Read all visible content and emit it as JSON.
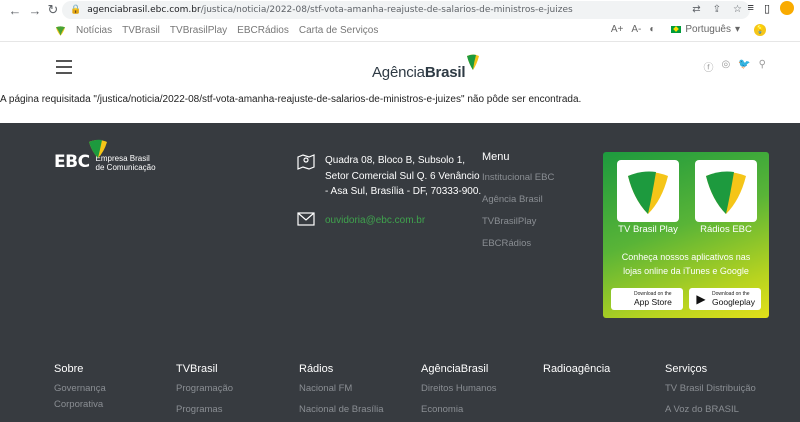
{
  "browser": {
    "url_host": "agenciabrasil.ebc.com.br",
    "url_path": "/justica/noticia/2022-08/stf-vota-amanha-reajuste-de-salarios-de-ministros-e-juizes"
  },
  "topnav": {
    "links": [
      "Notícias",
      "TVBrasil",
      "TVBrasilPlay",
      "EBCRádios",
      "Carta de Serviços"
    ],
    "font_increase": "A+",
    "font_decrease": "A-",
    "language": "Português"
  },
  "header": {
    "logo_regular": "Agência",
    "logo_bold": "Brasil"
  },
  "error_message": "A página requisitada \"/justica/noticia/2022-08/stf-vota-amanha-reajuste-de-salarios-de-ministros-e-juizes\" não pôde ser encontrada.",
  "footer": {
    "ebc_name": "EBC",
    "ebc_line1": "Empresa Brasil",
    "ebc_line2": "de Comunicação",
    "address_line1": "Quadra 08, Bloco B, Subsolo 1,",
    "address_line2": "Setor Comercial Sul Q. 6 Venâncio",
    "address_line3": "- Asa Sul, Brasília - DF, 70333-900.",
    "email": "ouvidoria@ebc.com.br",
    "menu": {
      "title": "Menu",
      "items": [
        "Institucional EBC",
        "Agência Brasil",
        "TVBrasilPlay",
        "EBCRádios"
      ]
    },
    "apps": {
      "tv_label": "TV Brasil Play",
      "radio_label": "Rádios EBC",
      "note_line1": "Conheça nossos aplicativos nas",
      "note_line2": "lojas online da iTunes e Google",
      "appstore_small": "Download on the",
      "appstore_big": "App Store",
      "googleplay_small": "Download on the",
      "googleplay_big": "Googleplay"
    },
    "columns": [
      {
        "title": "Sobre",
        "items": [
          "Governança",
          "Corporativa"
        ]
      },
      {
        "title": "TVBrasil",
        "items": [
          "Programação",
          "Programas"
        ]
      },
      {
        "title": "Rádios",
        "items": [
          "Nacional FM",
          "Nacional de Brasília"
        ]
      },
      {
        "title": "AgênciaBrasil",
        "items": [
          "Direitos Humanos",
          "Economia"
        ]
      },
      {
        "title": "Radioagência",
        "items": []
      },
      {
        "title": "Serviços",
        "items": [
          "TV Brasil Distribuição",
          "A Voz do BRASIL"
        ]
      }
    ]
  },
  "colors": {
    "footer_bg": "#373b40",
    "accent_green": "#3fa34d",
    "accent_yellow": "#e3e01a"
  }
}
